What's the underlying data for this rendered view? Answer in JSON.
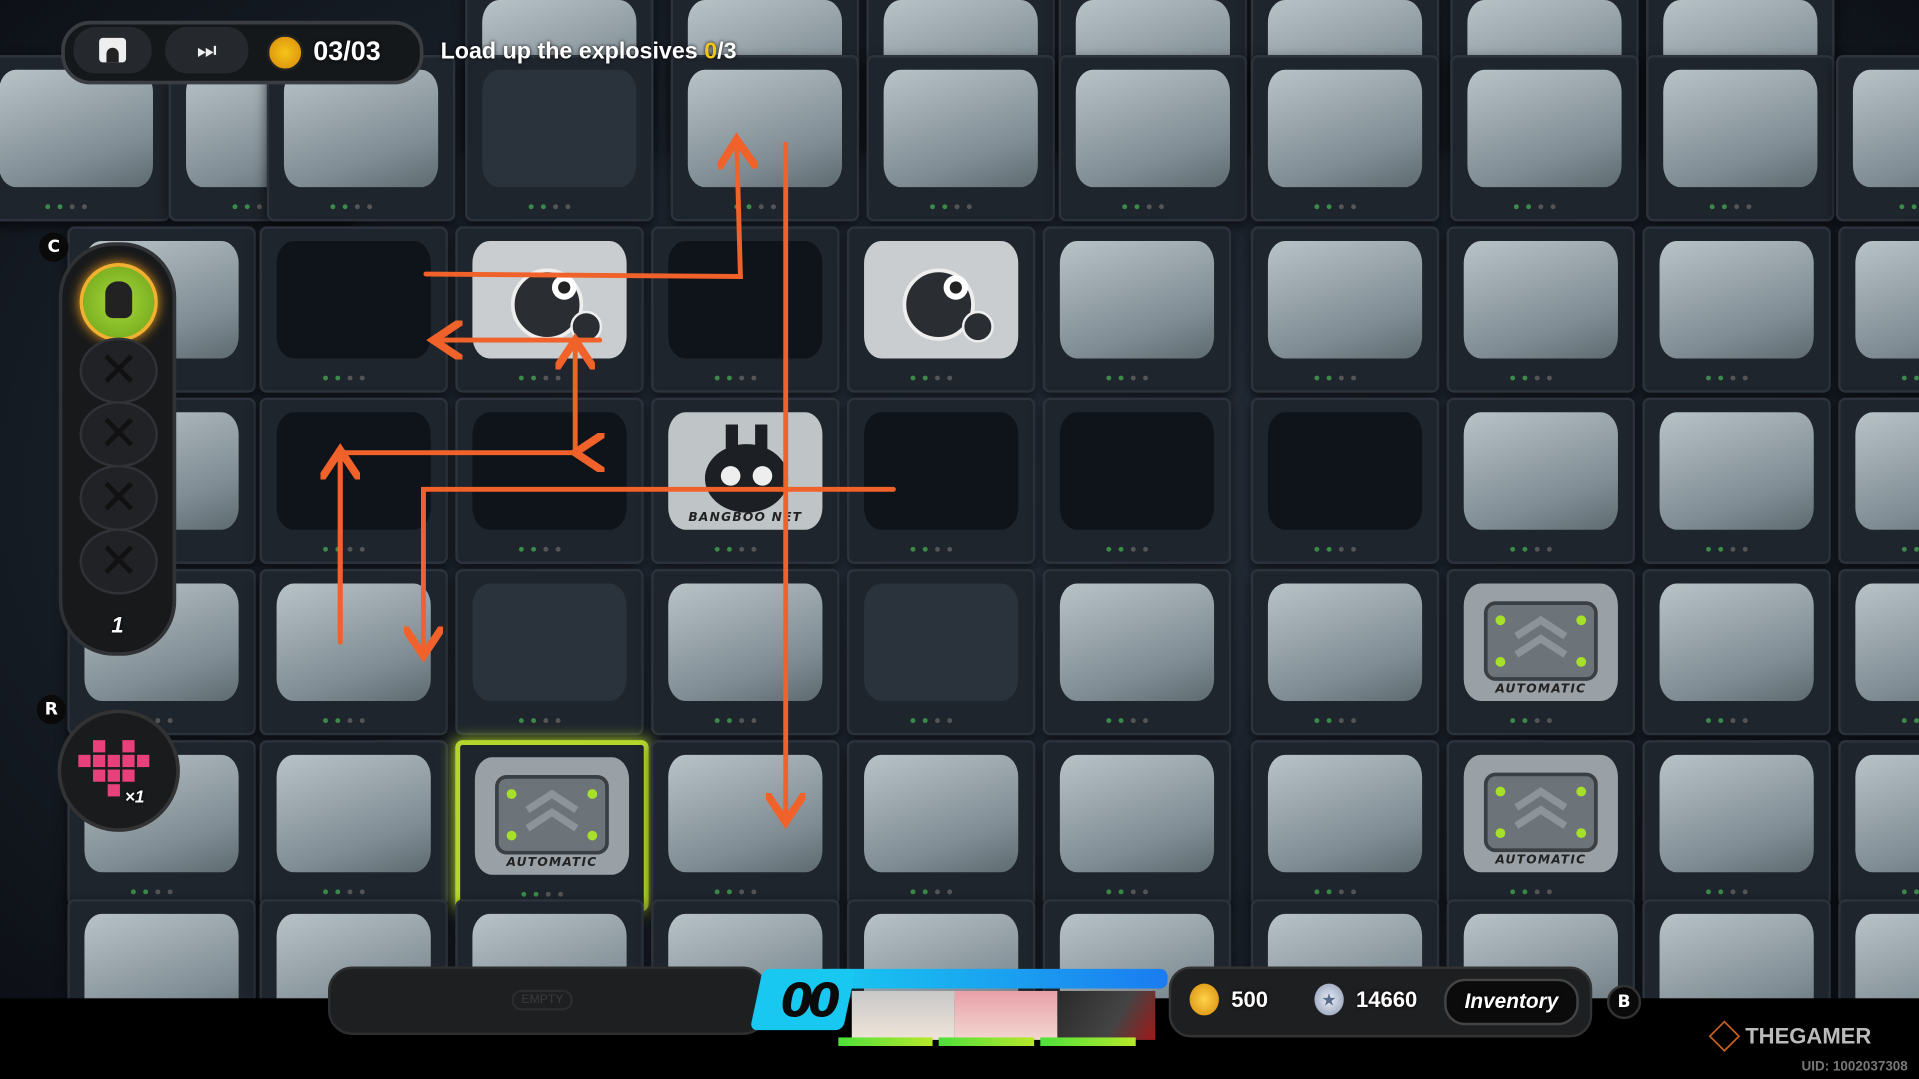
{
  "hud": {
    "profile_icon": "person-icon",
    "skip_icon": "fast-forward-icon",
    "gear_count": "03/03",
    "objective_text": "Load up the explosives",
    "objective_progress_done": "0",
    "objective_progress_total": "/3"
  },
  "left_panel": {
    "c_key": "C",
    "item_count": "1",
    "r_key": "R",
    "pattern_multiplier": "×1"
  },
  "board": {
    "bangboo_label": "BANGBOO NET",
    "crate_label": "AUTOMATIC"
  },
  "bottom_bar": {
    "empty_label": "EMPTY",
    "squad_number": "00",
    "gold": "500",
    "stars": "14660",
    "inventory_label": "Inventory",
    "b_key": "B"
  },
  "watermark": {
    "brand": "THEGAMER",
    "uid": "UID: 1002037308"
  },
  "colors": {
    "arrow": "#f0622a",
    "highlight": "#b5d62a",
    "accent_cyan": "#19c8f0",
    "objective_progress": "#f5c518"
  }
}
